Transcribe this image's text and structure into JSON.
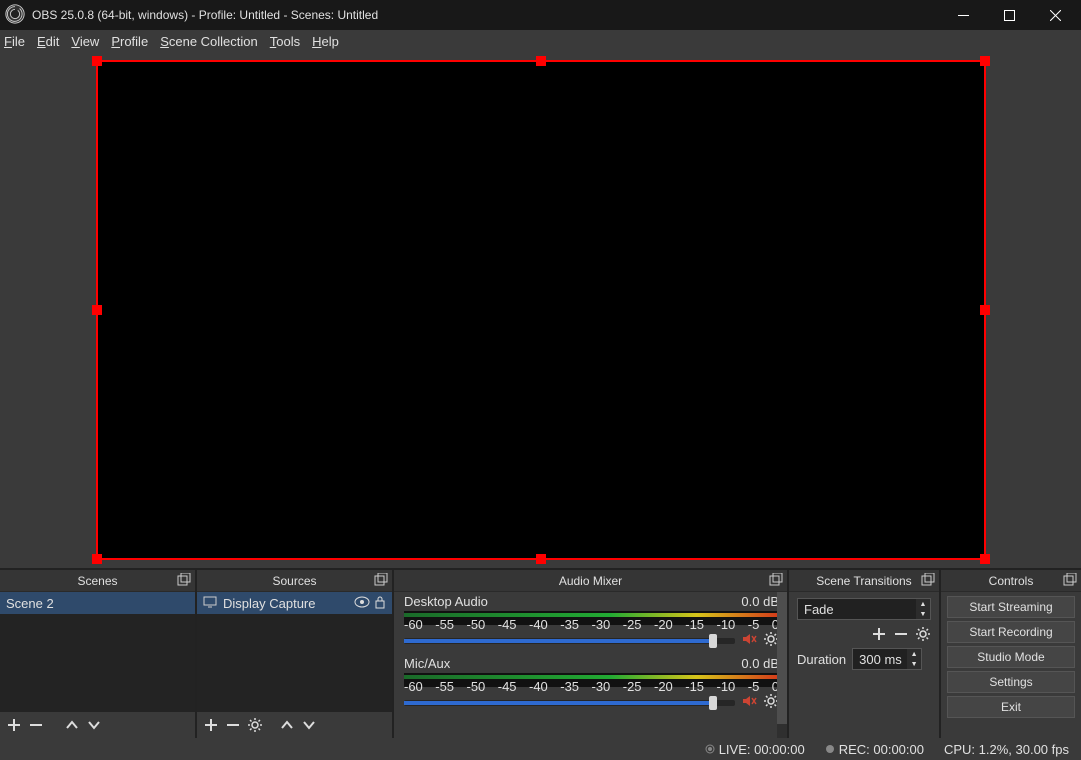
{
  "title": "OBS 25.0.8 (64-bit, windows) - Profile: Untitled - Scenes: Untitled",
  "menu": {
    "file": "File",
    "edit": "Edit",
    "view": "View",
    "profile": "Profile",
    "scene_collection": "Scene Collection",
    "tools": "Tools",
    "help": "Help"
  },
  "panels": {
    "scenes": {
      "title": "Scenes",
      "items": [
        "Scene 2"
      ]
    },
    "sources": {
      "title": "Sources",
      "items": [
        "Display Capture"
      ]
    },
    "mixer": {
      "title": "Audio Mixer",
      "ticks": [
        "-60",
        "-55",
        "-50",
        "-45",
        "-40",
        "-35",
        "-30",
        "-25",
        "-20",
        "-15",
        "-10",
        "-5",
        "0"
      ],
      "tracks": [
        {
          "name": "Desktop Audio",
          "level": "0.0 dB"
        },
        {
          "name": "Mic/Aux",
          "level": "0.0 dB"
        }
      ]
    },
    "transitions": {
      "title": "Scene Transitions",
      "value": "Fade",
      "duration_label": "Duration",
      "duration_value": "300 ms"
    },
    "controls": {
      "title": "Controls",
      "buttons": [
        "Start Streaming",
        "Start Recording",
        "Studio Mode",
        "Settings",
        "Exit"
      ]
    }
  },
  "status": {
    "live": "LIVE: 00:00:00",
    "rec": "REC: 00:00:00",
    "cpu": "CPU: 1.2%, 30.00 fps"
  }
}
